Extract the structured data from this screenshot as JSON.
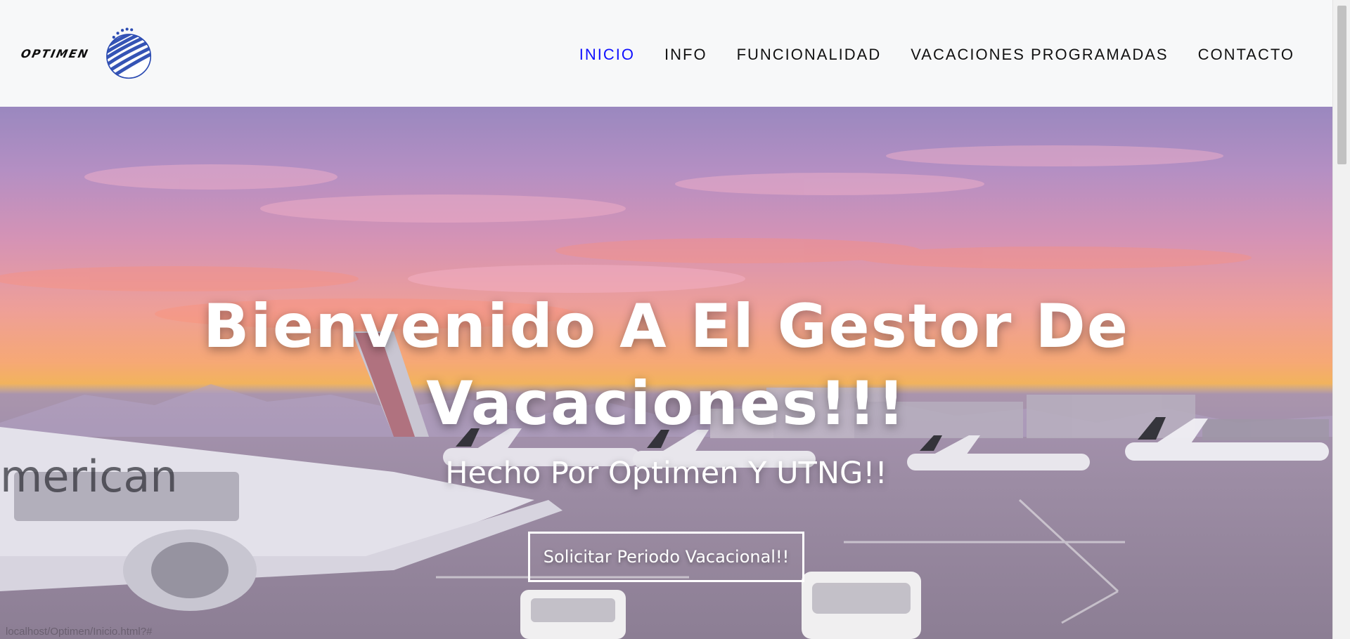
{
  "brand": {
    "logo_text": "OPTIMEN",
    "mark_icon": "globe-icon"
  },
  "nav": {
    "items": [
      {
        "label": "INICIO",
        "active": true
      },
      {
        "label": "INFO",
        "active": false
      },
      {
        "label": "FUNCIONALIDAD",
        "active": false
      },
      {
        "label": "VACACIONES PROGRAMADAS",
        "active": false
      },
      {
        "label": "CONTACTO",
        "active": false
      }
    ]
  },
  "hero": {
    "title": "Bienvenido A El Gestor De Vacaciones!!!",
    "subtitle": "Hecho Por Optimen Y UTNG!!",
    "button_label": "Solicitar Periodo Vacacional!!"
  },
  "status": {
    "hover_url": "localhost/Optimen/Inicio.html?#"
  },
  "colors": {
    "nav_active": "#1010ff",
    "nav_default": "#111111",
    "navbar_bg": "#f7f8f9",
    "hero_text": "#ffffff"
  }
}
